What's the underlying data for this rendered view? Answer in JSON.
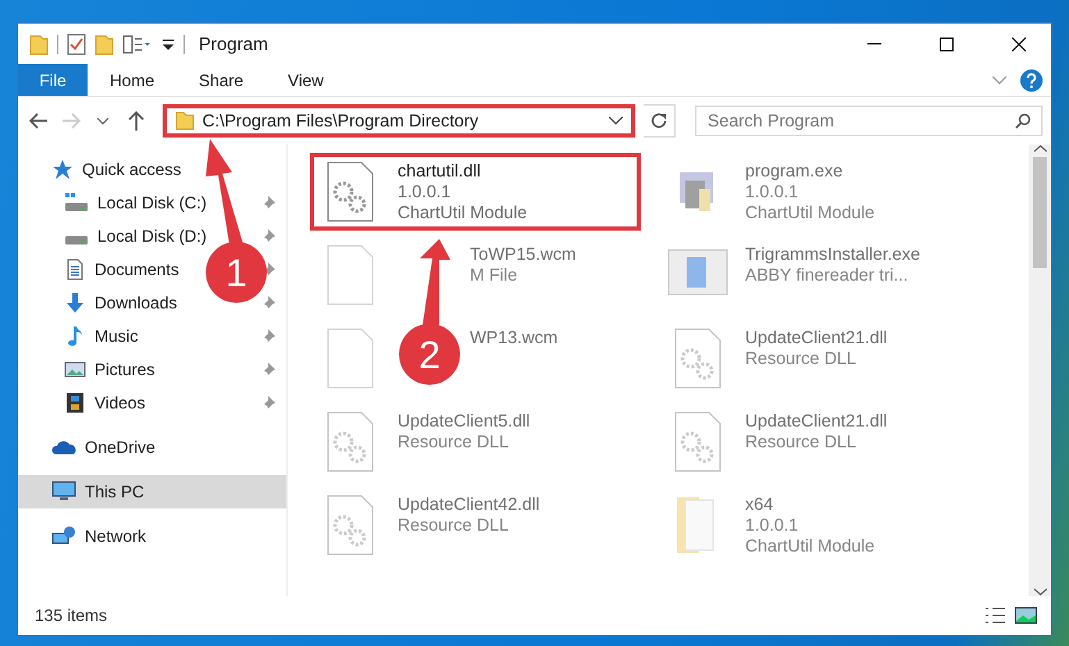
{
  "window": {
    "title": "Program"
  },
  "ribbon_tabs": [
    {
      "label": "File",
      "selected": true
    },
    {
      "label": "Home",
      "selected": false
    },
    {
      "label": "Share",
      "selected": false
    },
    {
      "label": "View",
      "selected": false
    }
  ],
  "address_bar": {
    "path": "C:\\Program Files\\Program Directory",
    "highlighted": true
  },
  "search": {
    "placeholder": "Search Program"
  },
  "sidebar": {
    "items": [
      {
        "label": "Quick access",
        "kind": "star",
        "selected": false,
        "children": [
          {
            "label": "Local Disk (C:)",
            "kind": "system-disk",
            "selected": false,
            "pinned": true
          },
          {
            "label": "Local Disk (D:)",
            "kind": "disk",
            "selected": false,
            "pinned": true
          },
          {
            "label": "Documents",
            "kind": "document",
            "selected": false,
            "pinned": true
          },
          {
            "label": "Downloads",
            "kind": "download",
            "selected": false,
            "pinned": true
          },
          {
            "label": "Music",
            "kind": "music",
            "selected": false,
            "pinned": true
          },
          {
            "label": "Pictures",
            "kind": "pictures",
            "selected": false,
            "pinned": true
          },
          {
            "label": "Videos",
            "kind": "video",
            "selected": false,
            "pinned": true
          }
        ]
      },
      {
        "label": "OneDrive",
        "kind": "cloud",
        "selected": false
      },
      {
        "label": "This PC",
        "kind": "computer",
        "selected": true
      },
      {
        "label": "Network",
        "kind": "network",
        "selected": false
      }
    ]
  },
  "files": [
    {
      "name": "chartutil.dll",
      "lines": [
        "1.0.0.1",
        "ChartUtil Module"
      ],
      "kind": "dll",
      "blurred": false,
      "highlighted": true
    },
    {
      "name": "program.exe",
      "lines": [
        "1.0.0.1",
        "ChartUtil Module"
      ],
      "kind": "exe",
      "blurred": true,
      "highlighted": false
    },
    {
      "name": "ToWP15.wcm",
      "lines": [
        "M File"
      ],
      "kind": "blank",
      "blurred": true,
      "highlighted": false,
      "covered": true
    },
    {
      "name": "TrigrammsInstaller.exe",
      "lines": [
        "ABBY finereader tri..."
      ],
      "kind": "installer",
      "blurred": true,
      "highlighted": false
    },
    {
      "name": "WP13.wcm",
      "kind": "blank",
      "blurred": true,
      "highlighted": false,
      "covered": true
    },
    {
      "name": "UpdateClient21.dll",
      "lines": [
        "Resource DLL"
      ],
      "kind": "dll",
      "blurred": true,
      "highlighted": false
    },
    {
      "name": "UpdateClient5.dll",
      "lines": [
        "Resource DLL"
      ],
      "kind": "dll",
      "blurred": true,
      "highlighted": false
    },
    {
      "name": "UpdateClient21.dll",
      "lines": [
        "Resource DLL"
      ],
      "kind": "dll",
      "blurred": true,
      "highlighted": false
    },
    {
      "name": "UpdateClient42.dll",
      "lines": [
        "Resource DLL"
      ],
      "kind": "dll",
      "blurred": true,
      "highlighted": false
    },
    {
      "name": "x64",
      "lines": [
        "1.0.0.1",
        "ChartUtil Module"
      ],
      "kind": "folder",
      "blurred": true,
      "highlighted": false
    }
  ],
  "status_bar": {
    "item_count": "135 items"
  },
  "annotations": [
    {
      "number": "1"
    },
    {
      "number": "2"
    }
  ]
}
